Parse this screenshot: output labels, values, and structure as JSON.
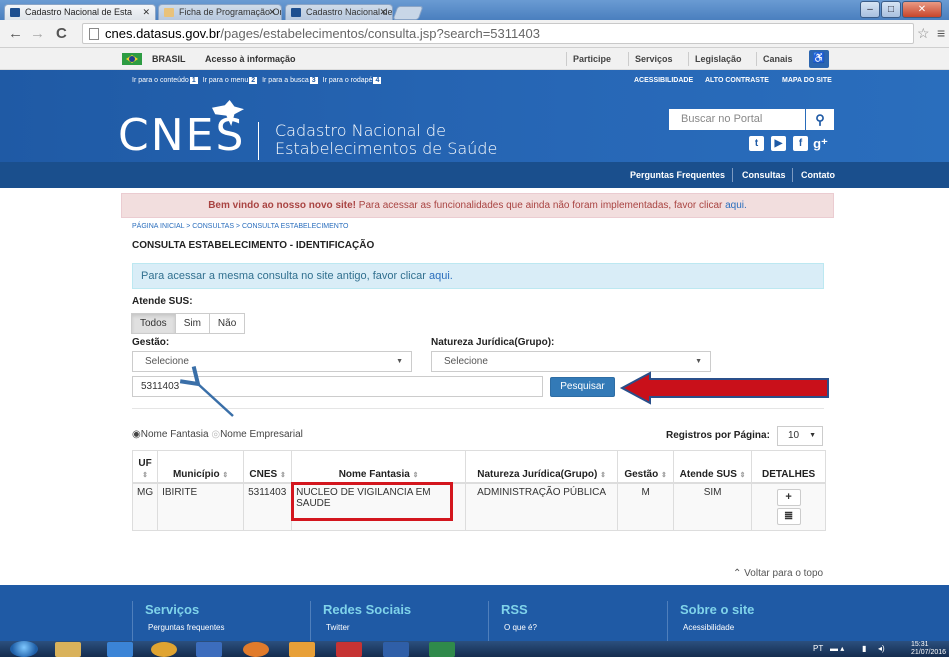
{
  "browser": {
    "tabs": [
      {
        "title": "Cadastro Nacional de Esta",
        "active": true
      },
      {
        "title": "Ficha de Programação Or",
        "active": false
      },
      {
        "title": "Cadastro Nacional de Esta",
        "active": false
      }
    ],
    "url_host": "cnes.datasus.gov.br",
    "url_rest": "/pages/estabelecimentos/consulta.jsp?search=5311403"
  },
  "govbar": {
    "country": "BRASIL",
    "access_info": "Acesso à informação",
    "links": [
      "Participe",
      "Serviços",
      "Legislação",
      "Canais"
    ]
  },
  "header": {
    "skip_links": [
      {
        "text": "Ir para o conteúdo",
        "key": "1"
      },
      {
        "text": "Ir para o menu",
        "key": "2"
      },
      {
        "text": "Ir para a busca",
        "key": "3"
      },
      {
        "text": "Ir para o rodapé",
        "key": "4"
      }
    ],
    "access_links": [
      "ACESSIBILIDADE",
      "ALTO CONTRASTE",
      "MAPA DO SITE"
    ],
    "logo": "CNES",
    "subtitle_line1": "Cadastro Nacional de",
    "subtitle_line2": "Estabelecimentos de Saúde",
    "search_placeholder": "Buscar no Portal",
    "subnav": [
      "Perguntas Frequentes",
      "Consultas",
      "Contato"
    ]
  },
  "welcome": {
    "bold": "Bem vindo ao nosso novo site!",
    "text": " Para acessar as funcionalidades que ainda não foram implementadas, favor clicar ",
    "link": "aqui."
  },
  "breadcrumb": "PÁGINA INICIAL > CONSULTAS > CONSULTA ESTABELECIMENTO",
  "page_title": "CONSULTA ESTABELECIMENTO - IDENTIFICAÇÃO",
  "info": {
    "text": "Para acessar a mesma consulta no site antigo, favor clicar ",
    "link": "aqui."
  },
  "form": {
    "atende_sus_label": "Atende SUS:",
    "atende_sus_options": [
      "Todos",
      "Sim",
      "Não"
    ],
    "atende_sus_selected": "Todos",
    "gestao_label": "Gestão:",
    "gestao_value": "Selecione",
    "natureza_label": "Natureza Jurídica(Grupo):",
    "natureza_value": "Selecione",
    "search_value": "5311403",
    "search_button": "Pesquisar"
  },
  "results": {
    "radio_options": [
      "Nome Fantasia",
      "Nome Empresarial"
    ],
    "radio_selected": "Nome Fantasia",
    "per_page_label": "Registros por Página:",
    "per_page_value": "10",
    "columns": [
      "UF",
      "Município",
      "CNES",
      "Nome Fantasia",
      "Natureza Jurídica(Grupo)",
      "Gestão",
      "Atende SUS",
      "DETALHES"
    ],
    "rows": [
      {
        "uf": "MG",
        "municipio": "IBIRITE",
        "cnes": "5311403",
        "nome": "NUCLEO DE VIGILANCIA EM SAUDE",
        "natureza": "ADMINISTRAÇÃO PÚBLICA",
        "gestao": "M",
        "sus": "SIM"
      }
    ]
  },
  "back_to_top": "Voltar para o topo",
  "footer": [
    {
      "head": "Serviços",
      "item": "Perguntas frequentes"
    },
    {
      "head": "Redes Sociais",
      "item": "Twitter"
    },
    {
      "head": "RSS",
      "item": "O que é?"
    },
    {
      "head": "Sobre o site",
      "item": "Acessibilidade"
    }
  ],
  "taskbar": {
    "lang": "PT",
    "time": "15:31",
    "date": "21/07/2016"
  },
  "colors": {
    "brand_blue": "#1f5aa5",
    "annotation_red": "#d3161e",
    "annotation_arrow_blue": "#3a6fa8"
  }
}
